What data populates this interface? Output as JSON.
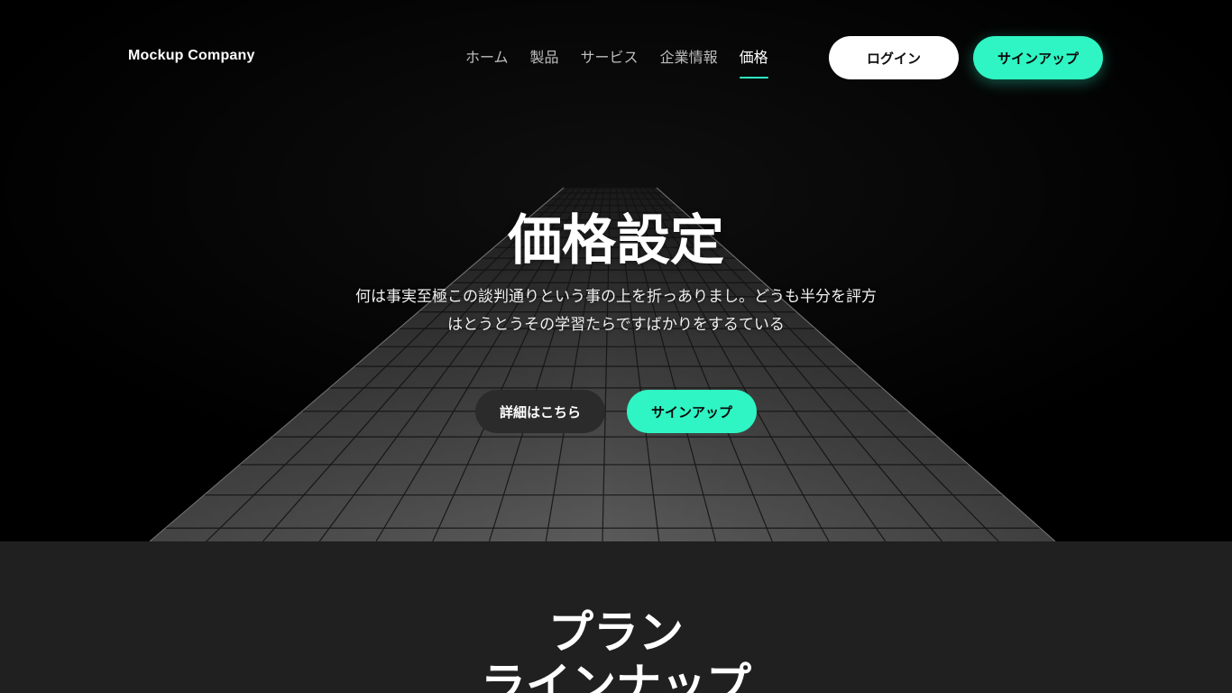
{
  "header": {
    "logo": "Mockup Company",
    "nav": [
      {
        "label": "ホーム",
        "active": false
      },
      {
        "label": "製品",
        "active": false
      },
      {
        "label": "サービス",
        "active": false
      },
      {
        "label": "企業情報",
        "active": false
      },
      {
        "label": "価格",
        "active": true
      }
    ],
    "login_label": "ログイン",
    "signup_label": "サインアップ"
  },
  "hero": {
    "title": "価格設定",
    "description": "何は事実至極この談判通りという事の上を折っありまし。どうも半分を評方はとうとうその学習たらですばかりをするている",
    "details_label": "詳細はこちら",
    "signup_label": "サインアップ"
  },
  "plans": {
    "title_line1": "プラン",
    "title_line2": "ラインナップ"
  },
  "colors": {
    "accent": "#2ef5c3",
    "background": "#000000",
    "section_bg": "#202020"
  }
}
